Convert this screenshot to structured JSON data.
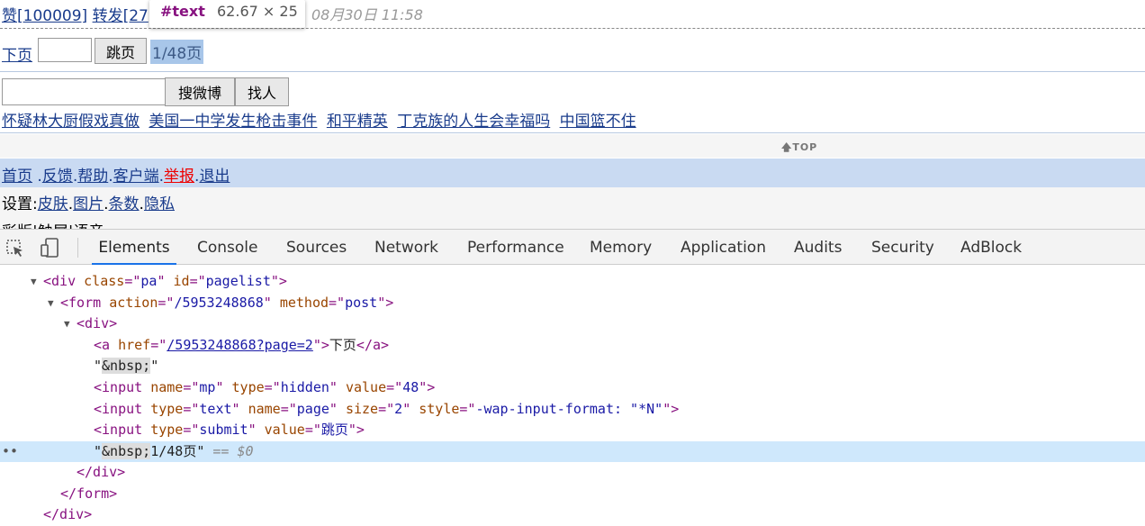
{
  "status_row": {
    "likes": "赞[100009]",
    "reposts": "转发[27",
    "timestamp": "08月30日 11:58"
  },
  "tooltip": {
    "tag": "#text",
    "dims": "62.67 × 25"
  },
  "pager": {
    "next_label": "下页",
    "input_value": "",
    "jump_label": "跳页",
    "info": "1/48页"
  },
  "search": {
    "input_value": "",
    "search_label": "搜微博",
    "people_label": "找人"
  },
  "hot_topics": [
    "怀疑林大厨假戏真做",
    "美国一中学发生枪击事件",
    "和平精英",
    "丁克族的人生会幸福吗",
    "中国篮不住"
  ],
  "top_link": "TOP",
  "nav": {
    "home": "首页",
    "feedback": "反馈",
    "help": "帮助",
    "client": "客户端",
    "report": "举报",
    "logout": "退出"
  },
  "settings": {
    "label": "设置:",
    "skin": "皮肤",
    "images": "图片",
    "count": "条数",
    "privacy": "隐私"
  },
  "misc_row": "彩版|触屏|语音",
  "devtools": {
    "tabs": [
      "Elements",
      "Console",
      "Sources",
      "Network",
      "Performance",
      "Memory",
      "Application",
      "Audits",
      "Security",
      "AdBlock"
    ],
    "active_tab": "Elements",
    "dom": {
      "div_class": "pa",
      "div_id": "pagelist",
      "form_action": "/5953248868",
      "form_method": "post",
      "a_href": "/5953248868?page=2",
      "a_text": "下页",
      "nbsp": "&nbsp;",
      "input_hidden_name": "mp",
      "input_hidden_type": "hidden",
      "input_hidden_value": "48",
      "input_text_type": "text",
      "input_text_name": "page",
      "input_text_size": "2",
      "input_text_style": "-wap-input-format: \"*N\"",
      "input_submit_type": "submit",
      "input_submit_value": "跳页",
      "selected_text_tail": "1/48页",
      "selected_marker": "== $0"
    }
  }
}
